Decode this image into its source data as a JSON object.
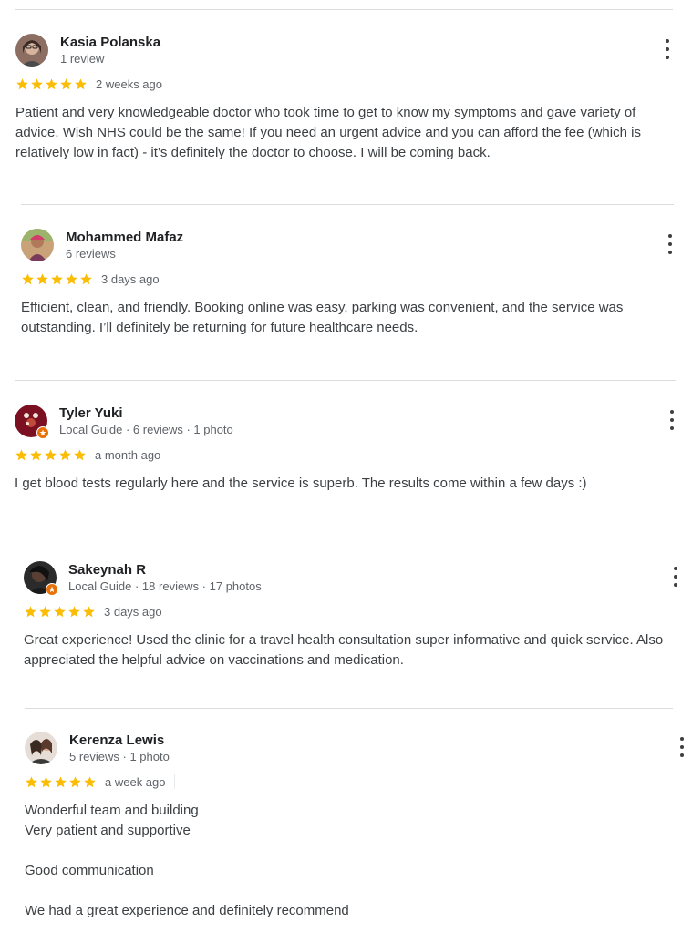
{
  "reviews": [
    {
      "name": "Kasia Polanska",
      "meta": "1 review",
      "rating": 5,
      "date": "2 weeks ago",
      "text": "Patient and very knowledgeable doctor who took time to get to know my symptoms and gave variety of advice. Wish NHS could be the same! If you need an urgent advice and you can afford the fee (which is relatively low in fact) - it’s definitely the doctor to choose. I will be coming back.",
      "local_guide": false
    },
    {
      "name": "Mohammed Mafaz",
      "meta": "6 reviews",
      "rating": 5,
      "date": "3 days ago",
      "text": "Efficient, clean, and friendly. Booking online was easy, parking was convenient, and the service was outstanding. I’ll definitely be returning for future healthcare needs.",
      "local_guide": false
    },
    {
      "name": "Tyler Yuki",
      "meta": "Local Guide · 6 reviews · 1 photo",
      "rating": 5,
      "date": "a month ago",
      "text": "I get blood tests regularly here and the service is superb. The results come within a few days :)",
      "local_guide": true
    },
    {
      "name": "Sakeynah R",
      "meta": "Local Guide · 18 reviews · 17 photos",
      "rating": 5,
      "date": "3 days ago",
      "text": "Great experience! Used the clinic for a travel health consultation super informative and quick service. Also appreciated the helpful advice on vaccinations and medication.",
      "local_guide": true
    },
    {
      "name": "Kerenza Lewis",
      "meta": "5 reviews · 1 photo",
      "rating": 5,
      "date": "a week ago",
      "text": "Wonderful team and building\nVery patient and supportive\n\nGood communication\n\nWe had a great experience and definitely recommend",
      "local_guide": false
    }
  ],
  "icons": {
    "star": "star-icon",
    "more": "more-vert-icon",
    "local_guide": "local-guide-badge-icon"
  },
  "colors": {
    "star": "#fbbc04",
    "local_guide_badge": "#e8710a",
    "divider": "#dadce0",
    "meta_text": "#5f6368"
  }
}
